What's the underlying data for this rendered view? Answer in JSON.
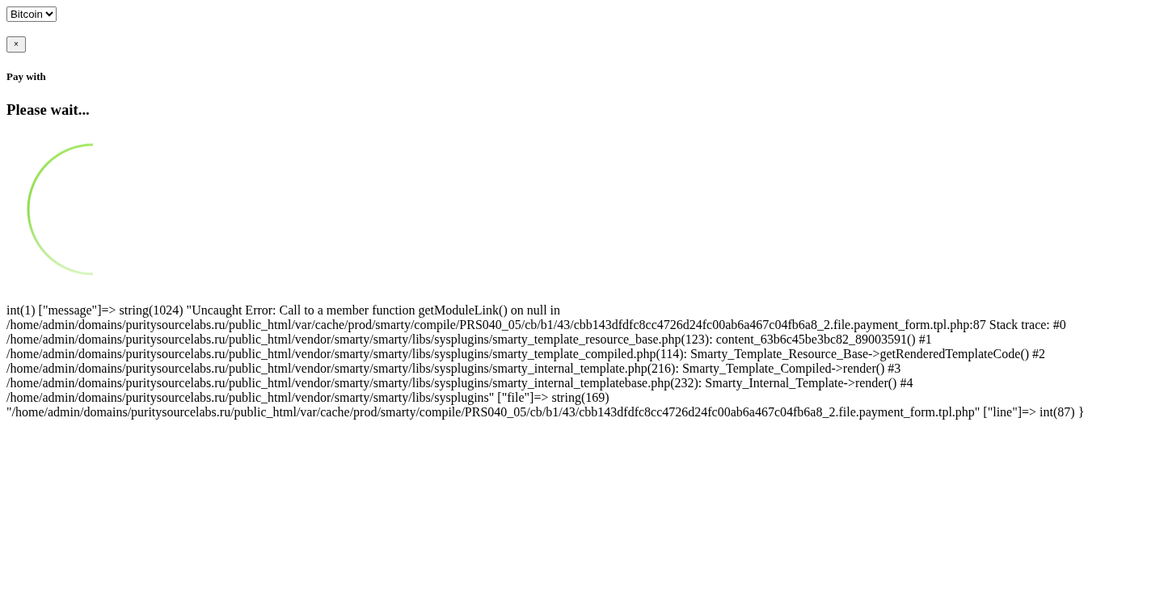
{
  "currency_select": {
    "value": "Bitcoin"
  },
  "close_button": {
    "label": "×"
  },
  "pay_with": "Pay with",
  "status": "Please wait...",
  "error_dump": "int(1) [\"message\"]=> string(1024) \"Uncaught Error: Call to a member function getModuleLink() on null in /home/admin/domains/puritysourcelabs.ru/public_html/var/cache/prod/smarty/compile/PRS040_05/cb/b1/43/cbb143dfdfc8cc4726d24fc00ab6a467c04fb6a8_2.file.payment_form.tpl.php:87 Stack trace: #0 /home/admin/domains/puritysourcelabs.ru/public_html/vendor/smarty/smarty/libs/sysplugins/smarty_template_resource_base.php(123): content_63b6c45be3bc82_89003591() #1 /home/admin/domains/puritysourcelabs.ru/public_html/vendor/smarty/smarty/libs/sysplugins/smarty_template_compiled.php(114): Smarty_Template_Resource_Base->getRenderedTemplateCode() #2 /home/admin/domains/puritysourcelabs.ru/public_html/vendor/smarty/smarty/libs/sysplugins/smarty_internal_template.php(216): Smarty_Template_Compiled->render() #3 /home/admin/domains/puritysourcelabs.ru/public_html/vendor/smarty/smarty/libs/sysplugins/smarty_internal_templatebase.php(232): Smarty_Internal_Template->render() #4 /home/admin/domains/puritysourcelabs.ru/public_html/vendor/smarty/smarty/libs/sysplugins\" [\"file\"]=> string(169) \"/home/admin/domains/puritysourcelabs.ru/public_html/var/cache/prod/smarty/compile/PRS040_05/cb/b1/43/cbb143dfdfc8cc4726d24fc00ab6a467c04fb6a8_2.file.payment_form.tpl.php\" [\"line\"]=> int(87) }"
}
